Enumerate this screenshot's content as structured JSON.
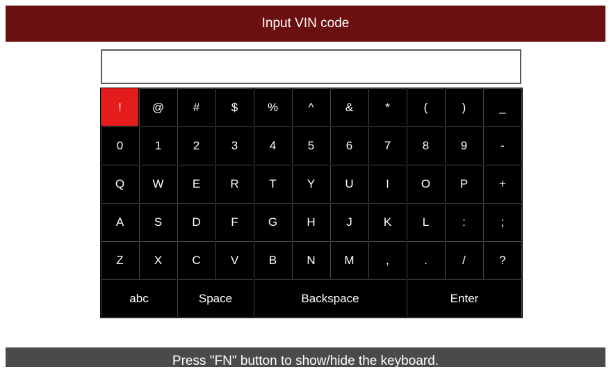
{
  "title": "Input VIN code",
  "vin_input": {
    "value": "",
    "placeholder": ""
  },
  "keyboard": {
    "selected_key": "!",
    "rows": [
      [
        "!",
        "@",
        "#",
        "$",
        "%",
        "^",
        "&",
        "*",
        "(",
        ")",
        "_"
      ],
      [
        "0",
        "1",
        "2",
        "3",
        "4",
        "5",
        "6",
        "7",
        "8",
        "9",
        "-"
      ],
      [
        "Q",
        "W",
        "E",
        "R",
        "T",
        "Y",
        "U",
        "I",
        "O",
        "P",
        "+"
      ],
      [
        "A",
        "S",
        "D",
        "F",
        "G",
        "H",
        "J",
        "K",
        "L",
        ":",
        ";"
      ],
      [
        "Z",
        "X",
        "C",
        "V",
        "B",
        "N",
        "M",
        ",",
        ".",
        "/",
        "?"
      ]
    ],
    "bottom_row": [
      "abc",
      "Space",
      "Backspace",
      "Enter"
    ]
  },
  "status_message": "Press \"FN\" button to show/hide the keyboard.",
  "colors": {
    "title_bar": "#6b1010",
    "selected_key": "#e51c1c",
    "key_background": "#000000",
    "status_bar": "#4a4a4a"
  }
}
